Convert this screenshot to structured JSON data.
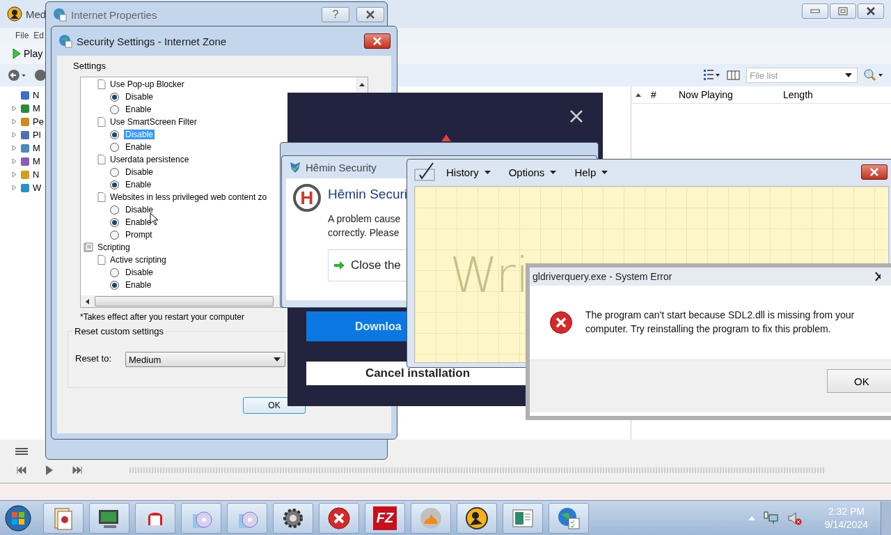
{
  "media_player": {
    "title": "Med",
    "menu": [
      "File",
      "Ed"
    ],
    "play_label": "Play",
    "tree": [
      {
        "label": "N",
        "expandable": false
      },
      {
        "label": "M",
        "expandable": true
      },
      {
        "label": "Pe",
        "expandable": true
      },
      {
        "label": "Pl",
        "expandable": true
      },
      {
        "label": "M",
        "expandable": true
      },
      {
        "label": "M",
        "expandable": true
      },
      {
        "label": "N",
        "expandable": true
      },
      {
        "label": "W",
        "expandable": true
      }
    ],
    "list_filter": {
      "placeholder": "File list"
    },
    "columns": [
      "#",
      "Now Playing",
      "Length"
    ]
  },
  "internet_properties": {
    "title": "Internet Properties",
    "help_label": "?"
  },
  "security_settings": {
    "title": "Security Settings - Internet Zone",
    "group_label": "Settings",
    "settings": [
      {
        "kind": "setting",
        "label": "Use Pop-up Blocker",
        "options": [
          {
            "label": "Disable",
            "selected": true,
            "focused": false
          },
          {
            "label": "Enable",
            "selected": false,
            "focused": false
          }
        ]
      },
      {
        "kind": "setting",
        "label": "Use SmartScreen Filter",
        "options": [
          {
            "label": "Disable",
            "selected": true,
            "focused": true
          },
          {
            "label": "Enable",
            "selected": false,
            "focused": false
          }
        ]
      },
      {
        "kind": "setting",
        "label": "Userdata persistence",
        "options": [
          {
            "label": "Disable",
            "selected": false,
            "focused": false
          },
          {
            "label": "Enable",
            "selected": true,
            "focused": false
          }
        ]
      },
      {
        "kind": "setting",
        "label": "Websites in less privileged web content zo",
        "options": [
          {
            "label": "Disable",
            "selected": false,
            "focused": false
          },
          {
            "label": "Enable",
            "selected": true,
            "focused": false
          },
          {
            "label": "Prompt",
            "selected": false,
            "focused": false
          }
        ]
      },
      {
        "kind": "category",
        "label": "Scripting",
        "children": [
          {
            "kind": "setting",
            "label": "Active scripting",
            "options": [
              {
                "label": "Disable",
                "selected": false,
                "focused": false
              },
              {
                "label": "Enable",
                "selected": true,
                "focused": false
              }
            ]
          }
        ]
      }
    ],
    "note": "*Takes effect after you restart your computer",
    "reset_group": "Reset custom settings",
    "reset_label": "Reset to:",
    "reset_value": "Medium",
    "ok_label": "OK"
  },
  "installer_ad": {
    "download_label": "Downloa",
    "cancel_label": "Cancel installation"
  },
  "hemin_dialog": {
    "title": "Hêmin Security",
    "logo_letter": "H",
    "heading": "Hêmin Securi",
    "message_lines": [
      "A problem cause",
      "correctly. Please"
    ],
    "action_label": "Close the"
  },
  "math_panel": {
    "menus": [
      "History",
      "Options",
      "Help"
    ],
    "ink_text": "Wri"
  },
  "system_error": {
    "title": "gldriverquery.exe - System Error",
    "message": "The program can't start because SDL2.dll is missing from your computer. Try reinstalling the program to fix this problem.",
    "ok_label": "OK"
  },
  "taskbar": {
    "app_letters": "FZ",
    "time": "2:32 PM",
    "date": "9/14/2024"
  }
}
